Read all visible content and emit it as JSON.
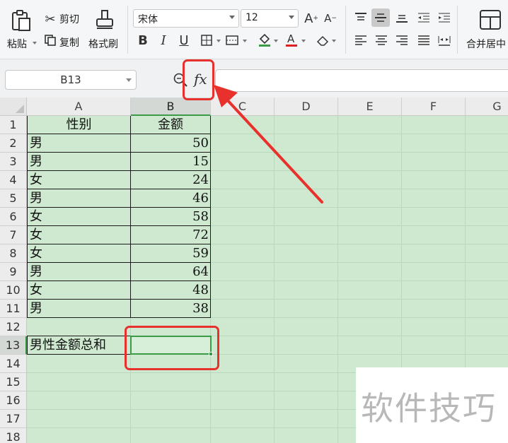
{
  "ribbon": {
    "paste": "粘贴",
    "cut": "剪切",
    "copy": "复制",
    "format_painter": "格式刷",
    "font_name": "宋体",
    "font_size": "12",
    "bold": "B",
    "italic": "I",
    "underline": "U",
    "merge_center": "合并居中"
  },
  "formula_bar": {
    "name_box": "B13",
    "fx_label": "fx",
    "formula": ""
  },
  "sheet": {
    "columns": [
      "A",
      "B",
      "C",
      "D",
      "E",
      "F",
      "G"
    ],
    "rows": [
      "1",
      "2",
      "3",
      "4",
      "5",
      "6",
      "7",
      "8",
      "9",
      "10",
      "11",
      "12",
      "13",
      "14",
      "15",
      "16",
      "17",
      "18"
    ],
    "header": {
      "a": "性别",
      "b": "金额"
    },
    "data": [
      {
        "a": "男",
        "b": "50"
      },
      {
        "a": "男",
        "b": "15"
      },
      {
        "a": "女",
        "b": "24"
      },
      {
        "a": "男",
        "b": "46"
      },
      {
        "a": "女",
        "b": "58"
      },
      {
        "a": "女",
        "b": "72"
      },
      {
        "a": "女",
        "b": "59"
      },
      {
        "a": "男",
        "b": "64"
      },
      {
        "a": "女",
        "b": "48"
      },
      {
        "a": "男",
        "b": "38"
      }
    ],
    "sum_label": "男性金额总和",
    "sum_value": "",
    "active_cell": "B13"
  },
  "watermark": "软件技巧",
  "colors": {
    "grid_bg": "#cfe9d1",
    "accent_green": "#3c9b46",
    "highlight_red": "#e8312c"
  }
}
